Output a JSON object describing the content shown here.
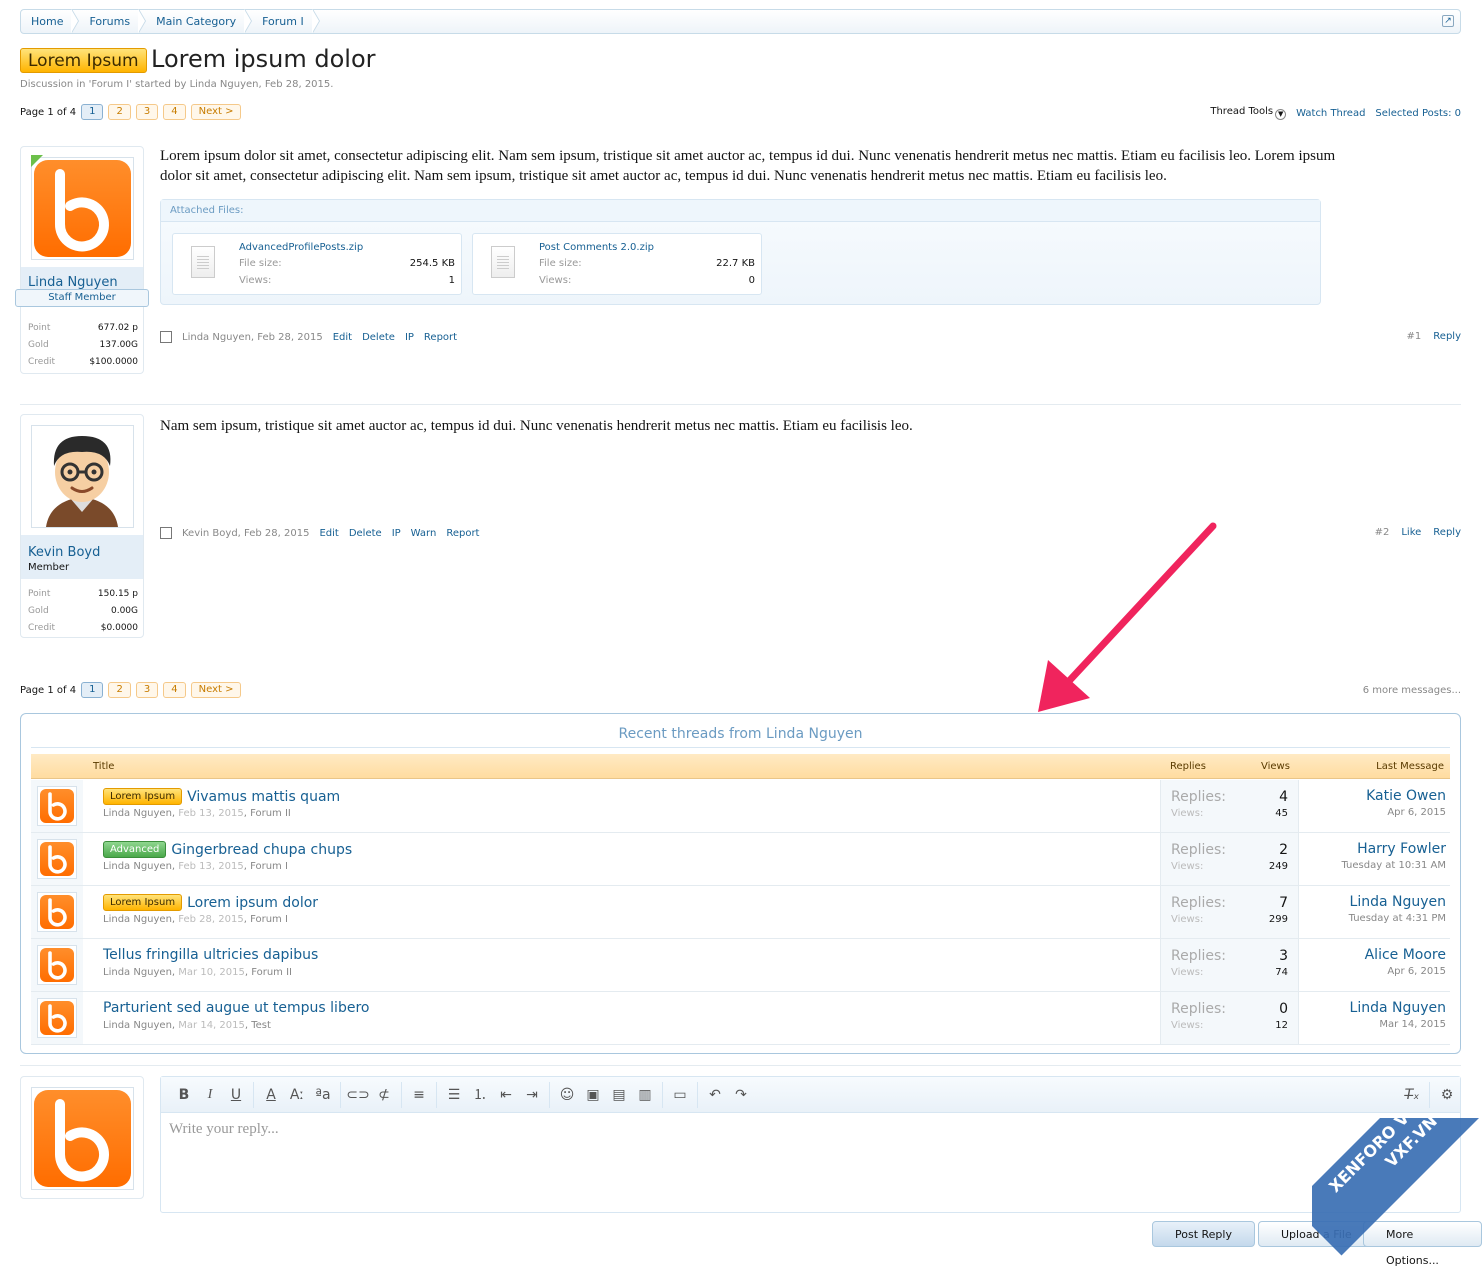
{
  "breadcrumb": [
    "Home",
    "Forums",
    "Main Category",
    "Forum I"
  ],
  "thread": {
    "prefix": "Lorem Ipsum",
    "title": "Lorem ipsum dolor",
    "description": "Discussion in 'Forum I' started by Linda Nguyen, Feb 28, 2015."
  },
  "pagenav": {
    "label": "Page 1 of 4",
    "pages": [
      "1",
      "2",
      "3",
      "4"
    ],
    "next": "Next >"
  },
  "thread_tools": {
    "tools": "Thread Tools",
    "watch": "Watch Thread",
    "selected": "Selected Posts: 0"
  },
  "post1": {
    "user": "Linda Nguyen",
    "user_title": "Staff Member",
    "stats": [
      {
        "k": "Point",
        "v": "677.02 p"
      },
      {
        "k": "Gold",
        "v": "137.00G"
      },
      {
        "k": "Credit",
        "v": "$100.0000"
      }
    ],
    "text": "Lorem ipsum dolor sit amet, consectetur adipiscing elit. Nam sem ipsum, tristique sit amet auctor ac, tempus id dui. Nunc venenatis hendrerit metus nec mattis. Etiam eu facilisis leo. Lorem ipsum dolor sit amet, consectetur adipiscing elit. Nam sem ipsum, tristique sit amet auctor ac, tempus id dui. Nunc venenatis hendrerit metus nec mattis. Etiam eu facilisis leo.",
    "attached_label": "Attached Files:",
    "files": [
      {
        "name": "AdvancedProfilePosts.zip",
        "size_label": "File size:",
        "size": "254.5 KB",
        "views_label": "Views:",
        "views": "1"
      },
      {
        "name": "Post Comments 2.0.zip",
        "size_label": "File size:",
        "size": "22.7 KB",
        "views_label": "Views:",
        "views": "0"
      }
    ],
    "meta": "Linda Nguyen, Feb 28, 2015",
    "actions": [
      "Edit",
      "Delete",
      "IP",
      "Report"
    ],
    "num": "#1",
    "reply": "Reply"
  },
  "post2": {
    "user": "Kevin Boyd",
    "user_title": "Member",
    "stats": [
      {
        "k": "Point",
        "v": "150.15 p"
      },
      {
        "k": "Gold",
        "v": "0.00G"
      },
      {
        "k": "Credit",
        "v": "$0.0000"
      }
    ],
    "text": "Nam sem ipsum, tristique sit amet auctor ac, tempus id dui. Nunc venenatis hendrerit metus nec mattis. Etiam eu facilisis leo.",
    "meta": "Kevin Boyd, Feb 28, 2015",
    "actions": [
      "Edit",
      "Delete",
      "IP",
      "Warn",
      "Report"
    ],
    "num": "#2",
    "like": "Like",
    "reply": "Reply"
  },
  "more_messages": "6 more messages...",
  "recent": {
    "title": "Recent threads from Linda Nguyen",
    "cols": {
      "title": "Title",
      "replies": "Replies",
      "views": "Views",
      "last": "Last Message"
    },
    "replies_label": "Replies:",
    "views_label": "Views:",
    "rows": [
      {
        "prefix": "Lorem Ipsum",
        "prefix_type": "lorem",
        "title": "Vivamus mattis quam",
        "author": "Linda Nguyen",
        "date": "Feb 13, 2015",
        "forum": "Forum II",
        "replies": "4",
        "views": "45",
        "last_user": "Katie Owen",
        "last_time": "Apr 6, 2015"
      },
      {
        "prefix": "Advanced",
        "prefix_type": "adv",
        "title": "Gingerbread chupa chups",
        "author": "Linda Nguyen",
        "date": "Feb 13, 2015",
        "forum": "Forum I",
        "replies": "2",
        "views": "249",
        "last_user": "Harry Fowler",
        "last_time": "Tuesday at 10:31 AM"
      },
      {
        "prefix": "Lorem Ipsum",
        "prefix_type": "lorem",
        "title": "Lorem ipsum dolor",
        "author": "Linda Nguyen",
        "date": "Feb 28, 2015",
        "forum": "Forum I",
        "replies": "7",
        "views": "299",
        "last_user": "Linda Nguyen",
        "last_time": "Tuesday at 4:31 PM"
      },
      {
        "prefix": "",
        "prefix_type": "",
        "title": "Tellus fringilla ultricies dapibus",
        "author": "Linda Nguyen",
        "date": "Mar 10, 2015",
        "forum": "Forum II",
        "replies": "3",
        "views": "74",
        "last_user": "Alice Moore",
        "last_time": "Apr 6, 2015"
      },
      {
        "prefix": "",
        "prefix_type": "",
        "title": "Parturient sed augue ut tempus libero",
        "author": "Linda Nguyen",
        "date": "Mar 14, 2015",
        "forum": "Test",
        "replies": "0",
        "views": "12",
        "last_user": "Linda Nguyen",
        "last_time": "Mar 14, 2015"
      }
    ]
  },
  "editor": {
    "placeholder": "Write your reply..."
  },
  "buttons": {
    "post": "Post Reply",
    "upload": "Upload a File",
    "more": "More Options..."
  },
  "watermark": {
    "line1": "XENFORO VIET NAM",
    "line2": "VXF.VN"
  },
  "colors": {
    "link": "#176093",
    "prefix": "#ffb400",
    "accent_arrow": "#f0245d",
    "logo": "#ff7000"
  }
}
